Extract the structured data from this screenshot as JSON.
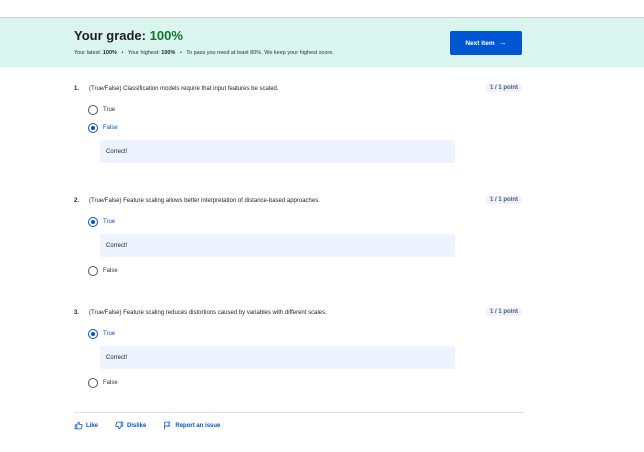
{
  "banner": {
    "title_prefix": "Your grade:",
    "grade": "100%",
    "latest_label": "Your latest:",
    "latest_value": "100%",
    "highest_label": "Your highest:",
    "highest_value": "100%",
    "pass_note": "To pass you need at least 80%. We keep your highest score.",
    "dot": "•",
    "next_label": "Next item",
    "next_arrow": "→",
    "accent_color": "#0056d2",
    "banner_color": "#d9f5ee"
  },
  "questions": [
    {
      "number": "1.",
      "text": "(True/False) Classification models require that input features be scaled.",
      "points": "1 / 1 point",
      "options": [
        "True",
        "False"
      ],
      "feedback": "Correct!"
    },
    {
      "number": "2.",
      "text": "(True/False) Feature scaling allows better interpretation of distance-based approaches.",
      "points": "1 / 1 point",
      "options": [
        "True",
        "False"
      ],
      "feedback": "Correct!"
    },
    {
      "number": "3.",
      "text": "(True/False) Feature scaling reduces distortions caused by variables with different scales.",
      "points": "1 / 1 point",
      "options": [
        "True",
        "False"
      ],
      "feedback": "Correct!"
    }
  ],
  "footer": {
    "like": "Like",
    "dislike": "Dislike",
    "report": "Report an issue"
  }
}
